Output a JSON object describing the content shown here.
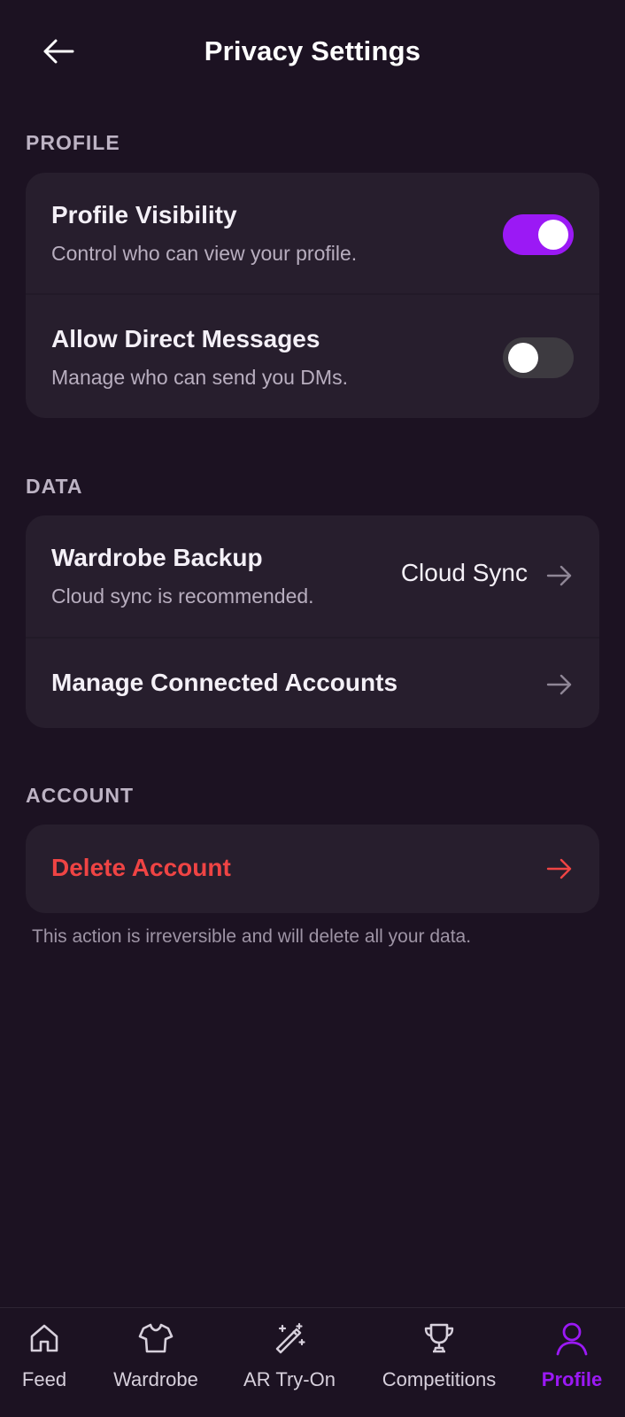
{
  "header": {
    "title": "Privacy Settings",
    "back_icon": "arrow-left-icon"
  },
  "sections": {
    "profile": {
      "title": "PROFILE",
      "items": [
        {
          "title": "Profile Visibility",
          "subtitle": "Control who can view your profile.",
          "toggle": true
        },
        {
          "title": "Allow Direct Messages",
          "subtitle": "Manage who can send you DMs.",
          "toggle": false
        }
      ]
    },
    "data": {
      "title": "DATA",
      "items": [
        {
          "title": "Wardrobe Backup",
          "subtitle": "Cloud sync is recommended.",
          "value": "Cloud Sync",
          "icon": "arrow-right-icon"
        },
        {
          "title": "Manage Connected Accounts",
          "icon": "arrow-right-icon"
        }
      ]
    },
    "account": {
      "title": "ACCOUNT",
      "items": [
        {
          "title": "Delete Account",
          "icon": "arrow-right-icon"
        }
      ],
      "footnote": "This action is irreversible and will delete all your data."
    }
  },
  "bottom_nav": {
    "items": [
      {
        "label": "Feed",
        "icon": "home-icon"
      },
      {
        "label": "Wardrobe",
        "icon": "shirt-icon"
      },
      {
        "label": "AR Try-On",
        "icon": "magic-wand-icon"
      },
      {
        "label": "Competitions",
        "icon": "trophy-icon"
      },
      {
        "label": "Profile",
        "icon": "user-icon",
        "active": true
      }
    ]
  },
  "colors": {
    "background": "#1c1222",
    "card": "#271e2d",
    "accent": "#9b19f5",
    "danger": "#ef4444",
    "toggle_off": "#3d3a40",
    "text_primary": "#f4f0f7",
    "text_secondary": "#b8aebf"
  }
}
